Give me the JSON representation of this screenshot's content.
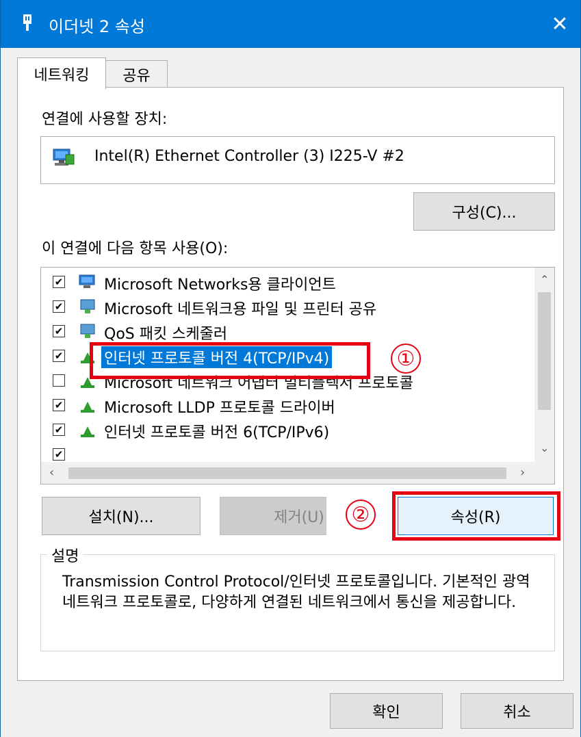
{
  "window": {
    "title": "이더넷 2 속성",
    "close_glyph": "✕",
    "icon": "network-adapter-icon"
  },
  "tabs": [
    {
      "label": "네트워킹",
      "active": true
    },
    {
      "label": "공유",
      "active": false
    }
  ],
  "device_label": "연결에 사용할 장치:",
  "device_name": "Intel(R) Ethernet Controller (3) I225-V #2",
  "configure_button": "구성(C)...",
  "items_label": "이 연결에 다음 항목 사용(O):",
  "items": [
    {
      "label": "Microsoft Networks용 클라이언트",
      "checked": true,
      "icon": "network-client-icon"
    },
    {
      "label": "Microsoft 네트워크용 파일 및 프린터 공유",
      "checked": true,
      "icon": "network-service-icon"
    },
    {
      "label": "QoS 패킷 스케줄러",
      "checked": true,
      "icon": "network-service-icon"
    },
    {
      "label": "인터넷 프로토콜 버전 4(TCP/IPv4)",
      "checked": true,
      "icon": "protocol-icon",
      "selected": true
    },
    {
      "label": "Microsoft 네트워크 어댑터 멀티플렉서 프로토콜",
      "checked": false,
      "icon": "protocol-icon"
    },
    {
      "label": "Microsoft LLDP 프로토콜 드라이버",
      "checked": true,
      "icon": "protocol-icon"
    },
    {
      "label": "인터넷 프로토콜 버전 6(TCP/IPv6)",
      "checked": true,
      "icon": "protocol-icon"
    }
  ],
  "buttons": {
    "install": "설치(N)...",
    "remove": "제거(U)",
    "properties": "속성(R)",
    "ok": "확인",
    "cancel": "취소"
  },
  "description_legend": "설명",
  "description_text": "Transmission Control Protocol/인터넷 프로토콜입니다. 기본적인 광역 네트워크 프로토콜로, 다양하게 연결된 네트워크에서 통신을 제공합니다.",
  "annotations": {
    "step1": "①",
    "step2": "②",
    "color": "#e60012"
  },
  "colors": {
    "titlebar": "#0078d7",
    "selection": "#0078d7"
  }
}
